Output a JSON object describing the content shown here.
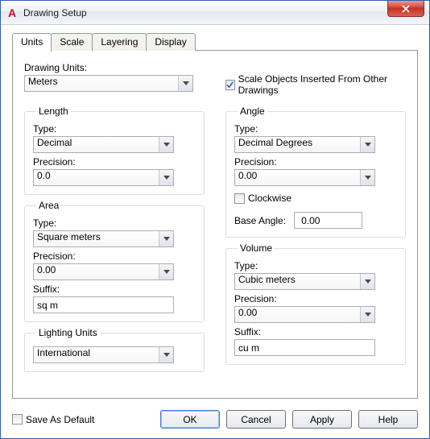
{
  "window": {
    "title": "Drawing Setup"
  },
  "tabs": {
    "units": "Units",
    "scale": "Scale",
    "layering": "Layering",
    "display": "Display"
  },
  "page": {
    "drawing_units_label": "Drawing Units:",
    "drawing_units_value": "Meters",
    "scale_objects_label": "Scale Objects Inserted From Other Drawings",
    "length": {
      "legend": "Length",
      "type_label": "Type:",
      "type_value": "Decimal",
      "precision_label": "Precision:",
      "precision_value": "0.0"
    },
    "area": {
      "legend": "Area",
      "type_label": "Type:",
      "type_value": "Square meters",
      "precision_label": "Precision:",
      "precision_value": "0.00",
      "suffix_label": "Suffix:",
      "suffix_value": "sq m"
    },
    "lighting": {
      "legend": "Lighting Units",
      "value": "International"
    },
    "angle": {
      "legend": "Angle",
      "type_label": "Type:",
      "type_value": "Decimal Degrees",
      "precision_label": "Precision:",
      "precision_value": "0.00",
      "clockwise_label": "Clockwise",
      "base_angle_label": "Base Angle:",
      "base_angle_value": "0.00"
    },
    "volume": {
      "legend": "Volume",
      "type_label": "Type:",
      "type_value": "Cubic meters",
      "precision_label": "Precision:",
      "precision_value": "0.00",
      "suffix_label": "Suffix:",
      "suffix_value": "cu m"
    }
  },
  "footer": {
    "save_as_default": "Save As Default",
    "ok": "OK",
    "cancel": "Cancel",
    "apply": "Apply",
    "help": "Help"
  }
}
